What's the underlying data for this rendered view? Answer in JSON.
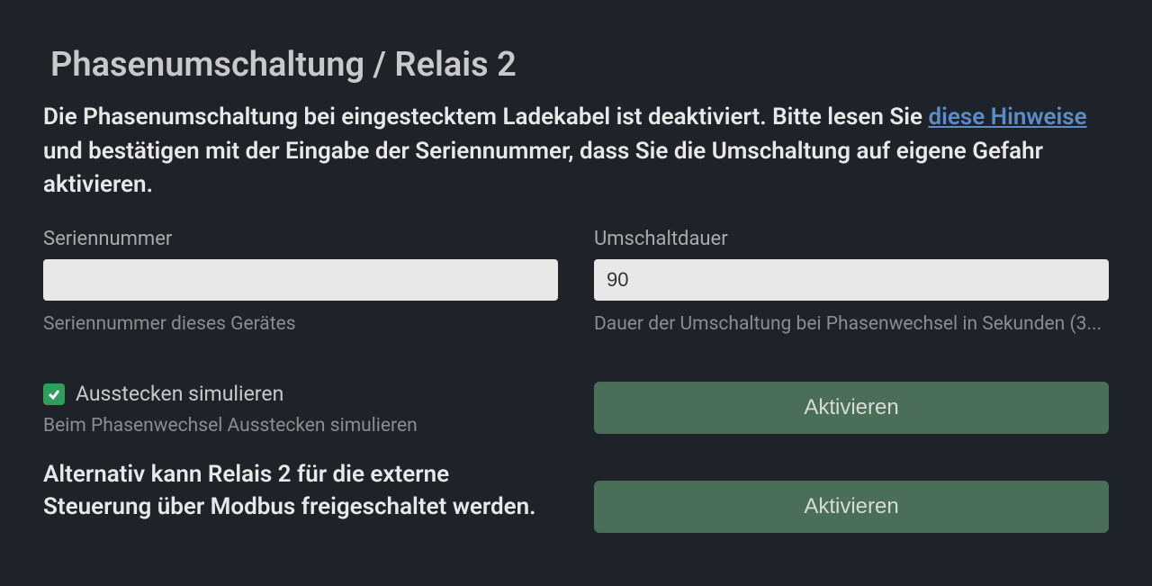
{
  "title": "Phasenumschaltung / Relais 2",
  "intro": {
    "before_link": "Die Phasenumschaltung bei eingestecktem Ladekabel ist deaktiviert. Bitte lesen Sie ",
    "link_text": "diese Hinweise",
    "after_link": " und bestätigen mit der Eingabe der Seriennummer, dass Sie die Umschaltung auf eigene Gefahr aktivieren."
  },
  "serial": {
    "label": "Seriennummer",
    "value": "",
    "help": "Seriennummer dieses Gerätes"
  },
  "duration": {
    "label": "Umschaltdauer",
    "value": "90",
    "help": "Dauer der Umschaltung bei Phasenwechsel in Sekunden (3..."
  },
  "simulate": {
    "label": "Ausstecken simulieren",
    "help": "Beim Phasenwechsel Ausstecken simulieren",
    "checked": true
  },
  "alt_text": "Alternativ kann Relais 2 für die externe Steuerung über Modbus freigeschaltet werden.",
  "buttons": {
    "activate1": "Aktivieren",
    "activate2": "Aktivieren"
  }
}
